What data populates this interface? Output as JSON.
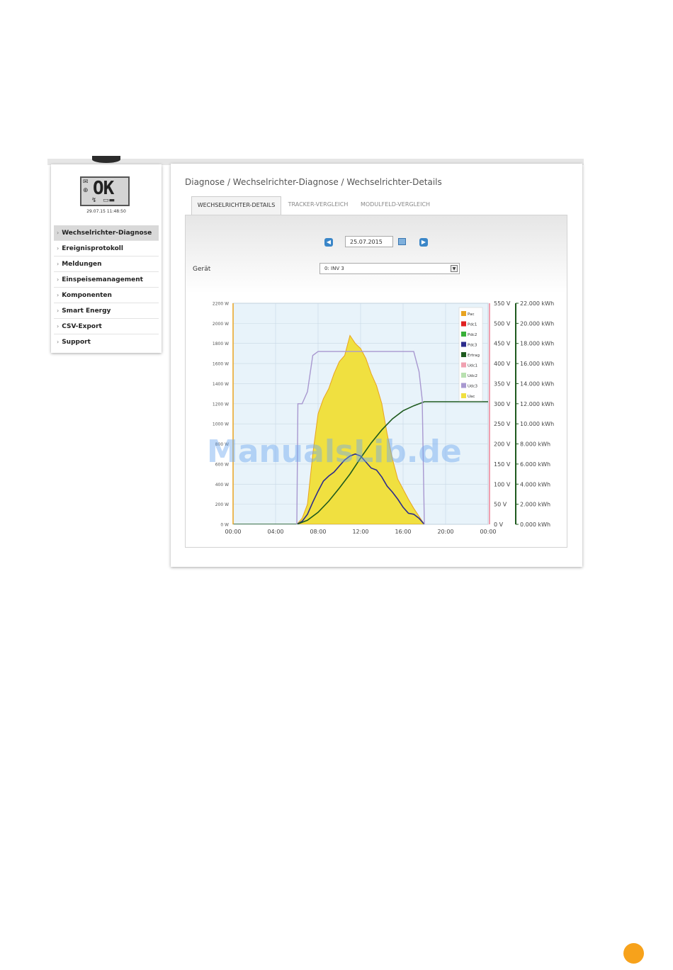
{
  "sidebar": {
    "lcd_status": "OK",
    "lcd_datetime": "29.07.15 11:48:50",
    "items": [
      {
        "label": "Wechselrichter-Diagnose",
        "active": true
      },
      {
        "label": "Ereignisprotokoll",
        "active": false
      },
      {
        "label": "Meldungen",
        "active": false
      },
      {
        "label": "Einspeisemanagement",
        "active": false
      },
      {
        "label": "Komponenten",
        "active": false
      },
      {
        "label": "Smart Energy",
        "active": false
      },
      {
        "label": "CSV-Export",
        "active": false
      },
      {
        "label": "Support",
        "active": false
      }
    ]
  },
  "main": {
    "breadcrumb": "Diagnose / Wechselrichter-Diagnose / Wechselrichter-Details",
    "tabs": [
      {
        "label": "WECHSELRICHTER-DETAILS",
        "active": true
      },
      {
        "label": "TRACKER-VERGLEICH",
        "active": false
      },
      {
        "label": "MODULFELD-VERGLEICH",
        "active": false
      }
    ],
    "date_value": "25.07.2015",
    "device_label": "Gerät",
    "device_value": "0: INV 3"
  },
  "watermark": "ManualsLib.de",
  "colors": {
    "Pac": "#e8a320",
    "Pdc1": "#e02020",
    "Pdc2": "#38b038",
    "Pdc3": "#2c2c8c",
    "Ertrag": "#1e5a1e",
    "Udc1": "#f0a0b0",
    "Udc2": "#b8e0b0",
    "Udc3": "#a898d0",
    "Uac": "#f0e040"
  },
  "chart_data": {
    "type": "area",
    "x_ticks": [
      "00:00",
      "04:00",
      "08:00",
      "12:00",
      "16:00",
      "20:00",
      "00:00"
    ],
    "y_left_ticks": [
      "0 W",
      "200 W",
      "400 W",
      "600 W",
      "800 W",
      "1000 W",
      "1200 W",
      "1400 W",
      "1600 W",
      "1800 W",
      "2000 W",
      "2200 W"
    ],
    "y_mid_ticks": [
      "0 V",
      "50 V",
      "100 V",
      "150 V",
      "200 V",
      "250 V",
      "300 V",
      "350 V",
      "400 V",
      "450 V",
      "500 V",
      "550 V"
    ],
    "y_right_ticks": [
      "0.000 kWh",
      "2.000 kWh",
      "4.000 kWh",
      "6.000 kWh",
      "8.000 kWh",
      "10.000 kWh",
      "12.000 kWh",
      "14.000 kWh",
      "16.000 kWh",
      "18.000 kWh",
      "20.000 kWh",
      "22.000 kWh"
    ],
    "x_range_hours": [
      0,
      24
    ],
    "y_left_range_w": [
      0,
      2200
    ],
    "y_mid_range_v": [
      0,
      550
    ],
    "y_right_range_kwh": [
      0,
      22
    ],
    "legend": [
      "Pac",
      "Pdc1",
      "Pdc2",
      "Pdc3",
      "Ertrag",
      "Udc1",
      "Udc2",
      "Udc3",
      "Uac"
    ],
    "legend_position": "top-right",
    "series": [
      {
        "name": "Pac",
        "axis": "W",
        "x": [
          6,
          6.5,
          7,
          7.5,
          8,
          8.5,
          9,
          9.5,
          10,
          10.5,
          11,
          11.5,
          12,
          12.5,
          13,
          13.5,
          14,
          14.5,
          15,
          15.5,
          16,
          16.5,
          17,
          17.5,
          18
        ],
        "values": [
          0,
          60,
          200,
          700,
          1100,
          1250,
          1350,
          1500,
          1620,
          1680,
          1880,
          1800,
          1750,
          1650,
          1500,
          1380,
          1200,
          900,
          650,
          450,
          350,
          250,
          160,
          80,
          0
        ]
      },
      {
        "name": "Pdc3",
        "axis": "W",
        "x": [
          6,
          6.5,
          7,
          7.5,
          8,
          8.5,
          9,
          9.5,
          10,
          10.5,
          11,
          11.5,
          12,
          12.5,
          13,
          13.5,
          14,
          14.5,
          15,
          15.5,
          16,
          16.5,
          17,
          17.5,
          18
        ],
        "values": [
          0,
          30,
          100,
          220,
          330,
          430,
          480,
          520,
          580,
          640,
          680,
          700,
          680,
          620,
          560,
          540,
          470,
          380,
          320,
          250,
          170,
          110,
          100,
          60,
          0
        ]
      },
      {
        "name": "Ertrag",
        "axis": "kWh",
        "x": [
          0,
          6,
          7,
          8,
          9,
          10,
          11,
          12,
          13,
          14,
          15,
          16,
          17,
          18,
          20,
          24
        ],
        "values": [
          0,
          0,
          0.4,
          1.2,
          2.3,
          3.6,
          5.0,
          6.6,
          8.1,
          9.4,
          10.5,
          11.3,
          11.8,
          12.2,
          12.2,
          12.2
        ]
      },
      {
        "name": "Udc3",
        "axis": "V",
        "x": [
          6,
          6.1,
          6.5,
          7,
          7.5,
          8,
          9,
          10,
          11,
          12,
          13,
          14,
          15,
          16,
          17,
          17.5,
          17.8,
          18
        ],
        "values": [
          0,
          300,
          300,
          330,
          420,
          430,
          430,
          430,
          430,
          430,
          430,
          430,
          430,
          430,
          430,
          380,
          310,
          0
        ]
      }
    ]
  }
}
